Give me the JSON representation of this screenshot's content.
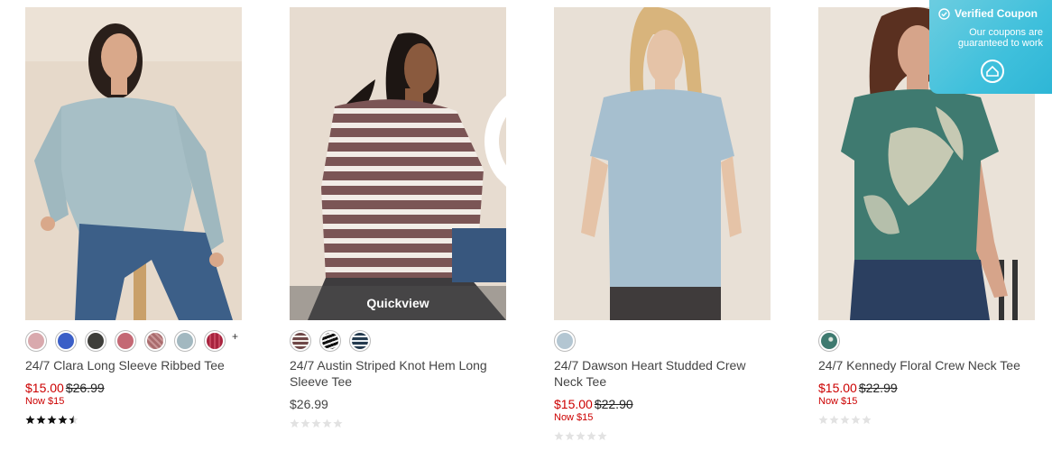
{
  "quickview_label": "Quickview",
  "more_swatches": "+",
  "coupon": {
    "title": "Verified Coupon",
    "text_line1": "Our coupons are",
    "text_line2": "guaranteed to work"
  },
  "products": [
    {
      "name": "24/7 Clara Long Sleeve Ribbed Tee",
      "sale_price": "$15.00",
      "original_price": "$26.99",
      "now_text": "Now $15",
      "rating": 4.5,
      "swatch_colors": [
        "#d9a9ad",
        "#3b5fc7",
        "#3e3e3a",
        "#c46874",
        "#a96b6d",
        "#a2b8c0",
        "#a8233e"
      ]
    },
    {
      "name": "24/7 Austin Striped Knot Hem Long Sleeve Tee",
      "regular_price": "$26.99",
      "rating": 0,
      "swatch_colors": [
        "striped-brown",
        "striped-black",
        "striped-navy"
      ]
    },
    {
      "name": "24/7 Dawson Heart Studded Crew Neck Tee",
      "sale_price": "$15.00",
      "original_price": "$22.90",
      "now_text": "Now $15",
      "rating": 0,
      "swatch_colors": [
        "#b3c6d2"
      ]
    },
    {
      "name": "24/7 Kennedy Floral Crew Neck Tee",
      "sale_price": "$15.00",
      "original_price": "$22.99",
      "now_text": "Now $15",
      "rating": 0,
      "swatch_colors": [
        "#3f7a70"
      ]
    }
  ]
}
